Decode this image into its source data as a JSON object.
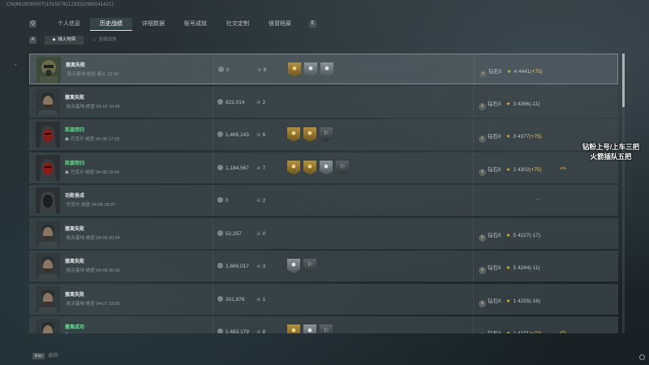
{
  "build_id": "CN(8618090007)1015079(1233)52980(41421)",
  "top_tabs": {
    "left_key": "Q",
    "right_key": "E",
    "items": [
      {
        "label": "个人信息",
        "active": false
      },
      {
        "label": "历史战绩",
        "active": true
      },
      {
        "label": "详细数据",
        "active": false
      },
      {
        "label": "账号成就",
        "active": false
      },
      {
        "label": "社交定制",
        "active": false
      },
      {
        "label": "很冒档案",
        "active": false
      }
    ]
  },
  "sub_tabs": {
    "left_key": "A",
    "right_key": "D",
    "items": [
      {
        "label": "烽火地带",
        "icon": "fire-zone-icon",
        "active": true
      },
      {
        "label": "全面战场",
        "active": false
      }
    ]
  },
  "left_marker": "+",
  "records": [
    {
      "result": "撤离失败",
      "result_color": "normal",
      "location": "航天基地·绝密·萧火 19:34",
      "value": "0",
      "kills": "9",
      "badges": [
        "gold",
        "silver",
        "silver"
      ],
      "rank": "钻石II",
      "stars": "4",
      "score": "4441",
      "delta": "(+75)",
      "delta_positive": true,
      "promo": false,
      "avatar": "gasmask"
    },
    {
      "result": "撤离失败",
      "result_color": "normal",
      "location": "航天基地·绝密 04-10 10:49",
      "value": "822,014",
      "kills": "2",
      "badges": [],
      "rank": "钻石II",
      "stars": "3",
      "score": "4366",
      "delta": "(-11)",
      "delta_positive": false,
      "promo": false,
      "avatar": "beard"
    },
    {
      "result": "凯旋而归",
      "result_color": "green",
      "location": "巴克什·绝密 04-08 17:19",
      "value": "1,466,143",
      "kills": "6",
      "badges": [
        "gold",
        "gold",
        "dark"
      ],
      "rank": "钻石II",
      "stars": "3",
      "score": "4377",
      "delta": "(+75)",
      "delta_positive": true,
      "promo": false,
      "avatar": "redhood"
    },
    {
      "result": "凯旋而归",
      "result_color": "green",
      "location": "巴克什·绝密 04-08 18:43",
      "value": "1,184,567",
      "kills": "7",
      "badges": [
        "gold",
        "gold",
        "silver",
        "dark"
      ],
      "rank": "钻石II",
      "stars": "2",
      "score": "4302",
      "delta": "(+75)",
      "delta_positive": true,
      "promo": true,
      "avatar": "redhood"
    },
    {
      "result": "功败垂成",
      "result_color": "normal",
      "location": "巴克什·绝密 04-08 18:37",
      "value": "0",
      "kills": "2",
      "badges": [],
      "rank": "",
      "stars": "",
      "score": "",
      "delta": "",
      "delta_positive": false,
      "promo": false,
      "avatar": "hood",
      "rank_empty": "--"
    },
    {
      "result": "撤离失败",
      "result_color": "normal",
      "location": "航天基地·绝密 04-08 00:24",
      "value": "52,357",
      "kills": "0",
      "badges": [],
      "rank": "钻石II",
      "stars": "5",
      "score": "4227",
      "delta": "(-17)",
      "delta_positive": false,
      "promo": false,
      "avatar": "beard"
    },
    {
      "result": "撤离失败",
      "result_color": "normal",
      "location": "航天基地·绝密 04-08 00:09",
      "value": "1,669,017",
      "kills": "3",
      "badges": [
        "silver",
        "dark"
      ],
      "rank": "钻石II",
      "stars": "5",
      "score": "4244",
      "delta": "(-11)",
      "delta_positive": false,
      "promo": false,
      "avatar": "beard"
    },
    {
      "result": "撤离失败",
      "result_color": "normal",
      "location": "航天基地·绝密 04-07 23:56",
      "value": "301,976",
      "kills": "1",
      "badges": [],
      "rank": "钻石II",
      "stars": "1",
      "score": "4255",
      "delta": "(-16)",
      "delta_positive": false,
      "promo": false,
      "avatar": "beard"
    },
    {
      "result": "撤离成功",
      "result_color": "green",
      "location": "",
      "value": "1,483,179",
      "kills": "8",
      "badges": [
        "gold",
        "silver",
        "dark"
      ],
      "rank": "钻石II",
      "stars": "1",
      "score": "4271",
      "delta": "(+72)",
      "delta_positive": true,
      "promo": true,
      "avatar": "beard"
    }
  ],
  "overlay_text": {
    "line1": "钻粉上号/上车三把",
    "line2": "火箭插队五把"
  },
  "bottom": {
    "key": "Esc",
    "label": "返回"
  },
  "colors": {
    "green": "#5fe08a",
    "gold": "#d7a73c",
    "accent_tab": "#d9d9d9"
  }
}
